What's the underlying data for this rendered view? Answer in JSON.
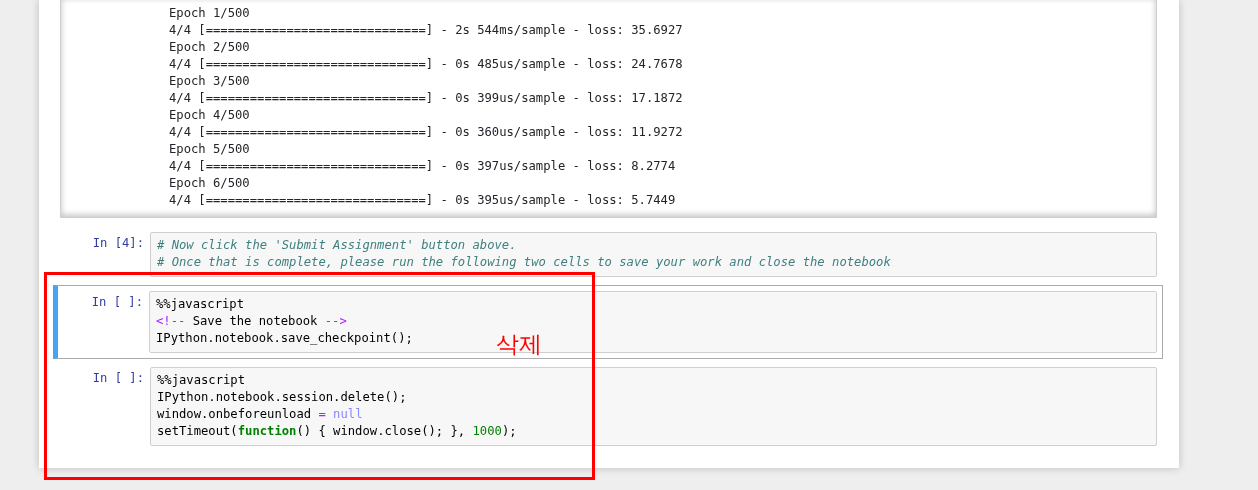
{
  "output": {
    "lines": [
      "Epoch 1/500",
      "4/4 [==============================] - 2s 544ms/sample - loss: 35.6927",
      "Epoch 2/500",
      "4/4 [==============================] - 0s 485us/sample - loss: 24.7678",
      "Epoch 3/500",
      "4/4 [==============================] - 0s 399us/sample - loss: 17.1872",
      "Epoch 4/500",
      "4/4 [==============================] - 0s 360us/sample - loss: 11.9272",
      "Epoch 5/500",
      "4/4 [==============================] - 0s 397us/sample - loss: 8.2774",
      "Epoch 6/500",
      "4/4 [==============================] - 0s 395us/sample - loss: 5.7449"
    ]
  },
  "cells": [
    {
      "prompt": "In [4]:",
      "selected": false,
      "lines": [
        [
          {
            "kind": "comment",
            "text": "# Now click the 'Submit Assignment' button above."
          }
        ],
        [
          {
            "kind": "comment",
            "text": "# Once that is complete, please run the following two cells to save your work and close the notebook"
          }
        ]
      ]
    },
    {
      "prompt": "In [ ]:",
      "selected": true,
      "lines": [
        [
          {
            "kind": "plain",
            "text": "%%javascript"
          }
        ],
        [
          {
            "kind": "markup",
            "text": "<!--"
          },
          {
            "kind": "plain",
            "text": " Save the notebook "
          },
          {
            "kind": "markup",
            "text": "-->"
          }
        ],
        [
          {
            "kind": "plain",
            "text": "IPython.notebook.save_checkpoint();"
          }
        ]
      ]
    },
    {
      "prompt": "In [ ]:",
      "selected": false,
      "lines": [
        [
          {
            "kind": "plain",
            "text": "%%javascript"
          }
        ],
        [
          {
            "kind": "plain",
            "text": "IPython.notebook.session.delete();"
          }
        ],
        [
          {
            "kind": "plain",
            "text": "window.onbeforeunload "
          },
          {
            "kind": "operator",
            "text": "="
          },
          {
            "kind": "literal",
            "text": " null"
          }
        ],
        [
          {
            "kind": "plain",
            "text": "setTimeout("
          },
          {
            "kind": "keyword",
            "text": "function"
          },
          {
            "kind": "plain",
            "text": "() { window.close(); }, "
          },
          {
            "kind": "number",
            "text": "1000"
          },
          {
            "kind": "plain",
            "text": ");"
          }
        ]
      ]
    }
  ],
  "annotation": {
    "text": "삭제"
  }
}
